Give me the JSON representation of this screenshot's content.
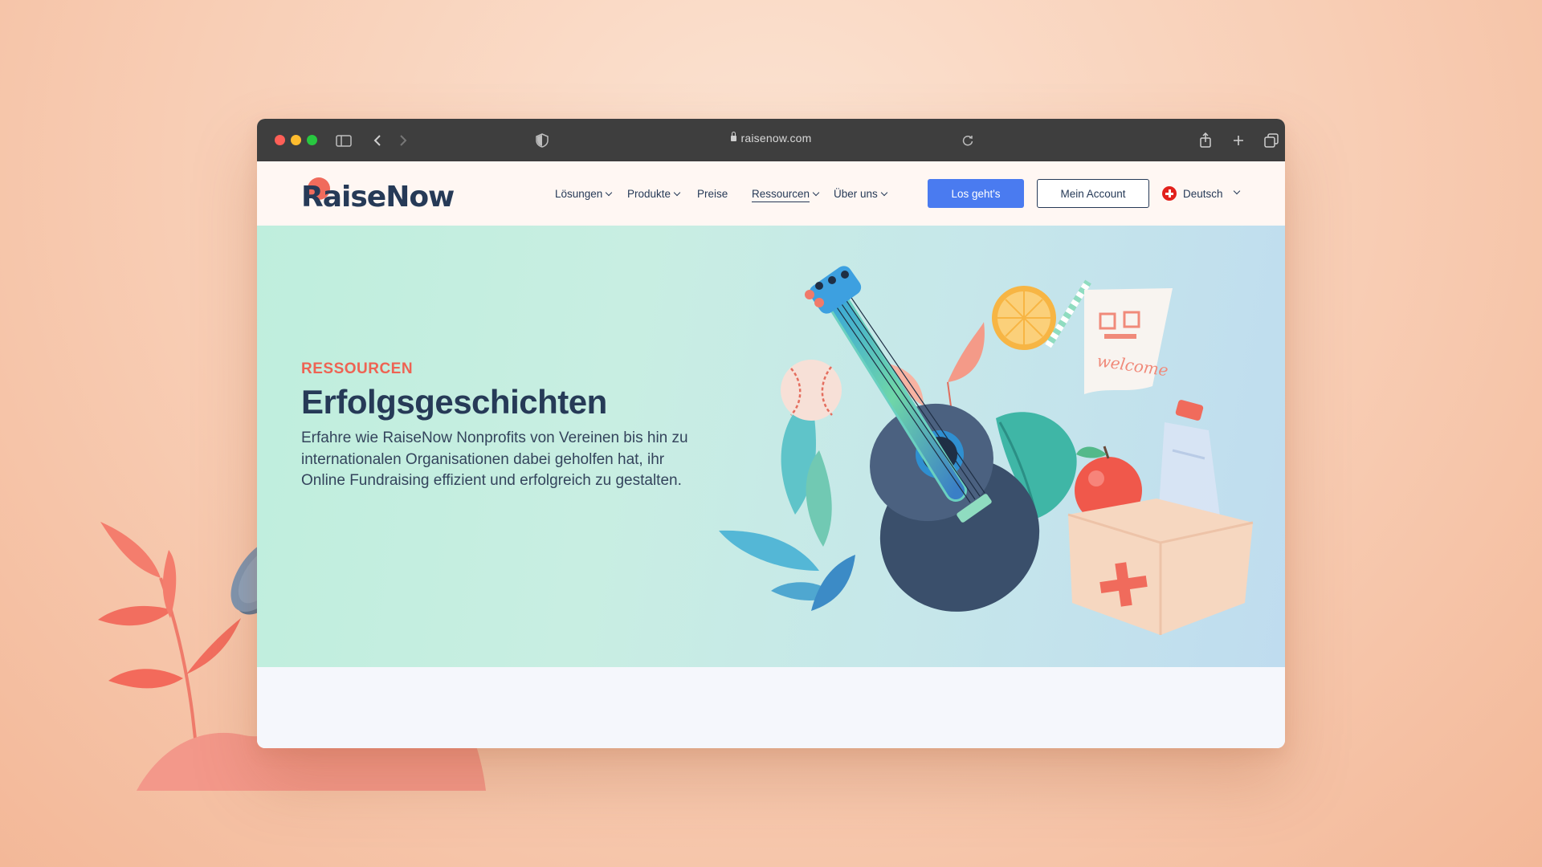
{
  "browser": {
    "url": "raisenow.com",
    "traffic_lights": [
      "#ff5f57",
      "#febc2e",
      "#28c840"
    ]
  },
  "site": {
    "logo": "RaiseNow",
    "nav": [
      {
        "label": "Lösungen",
        "dropdown": true
      },
      {
        "label": "Produkte",
        "dropdown": true
      },
      {
        "label": "Preise",
        "dropdown": false
      },
      {
        "label": "Ressourcen",
        "dropdown": true,
        "active": true
      },
      {
        "label": "Über uns",
        "dropdown": true
      }
    ],
    "cta_primary": "Los geht's",
    "cta_secondary": "Mein Account",
    "language": "Deutsch"
  },
  "hero": {
    "eyebrow": "RESSOURCEN",
    "title": "Erfolgsgeschichten",
    "description": "Erfahre wie RaiseNow Nonprofits von Vereinen bis hin zu internationalen Organisationen dabei geholfen hat, ihr Online Fundraising effizient und erfolgreich zu gestalten.",
    "illustration_text": "welcome"
  },
  "colors": {
    "brand_navy": "#263a57",
    "accent_coral": "#ee6353",
    "button_blue": "#4a7bf0"
  }
}
